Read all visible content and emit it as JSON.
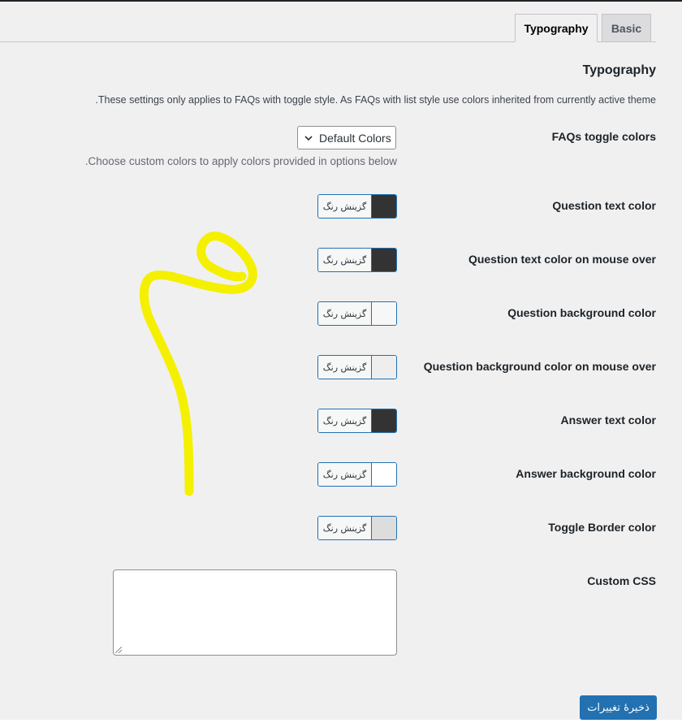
{
  "tabs": [
    {
      "label": "Typography",
      "active": true
    },
    {
      "label": "Basic",
      "active": false
    }
  ],
  "section": {
    "title": "Typography",
    "description": "These settings only applies to FAQs with toggle style. As FAQs with list style use colors inherited from currently active theme."
  },
  "toggle_colors": {
    "label": "FAQs toggle colors",
    "selected": "Default Colors",
    "hint": "Choose custom colors to apply colors provided in options below."
  },
  "color_button_text": "گزینش رنگ",
  "color_fields": [
    {
      "label": "Question text color",
      "swatch": "#333333"
    },
    {
      "label": "Question text color on mouse over",
      "swatch": "#333333"
    },
    {
      "label": "Question background color",
      "swatch": "#f7f7f7"
    },
    {
      "label": "Question background color on mouse over",
      "swatch": "#eeeeee"
    },
    {
      "label": "Answer text color",
      "swatch": "#333333"
    },
    {
      "label": "Answer background color",
      "swatch": "#ffffff"
    },
    {
      "label": "Toggle Border color",
      "swatch": "#dddddd"
    }
  ],
  "custom_css": {
    "label": "Custom CSS",
    "value": ""
  },
  "save_button": "ذخیرهٔ تغییرات",
  "colors": {
    "accent": "#2271b1",
    "annotation": "#f4f000"
  }
}
